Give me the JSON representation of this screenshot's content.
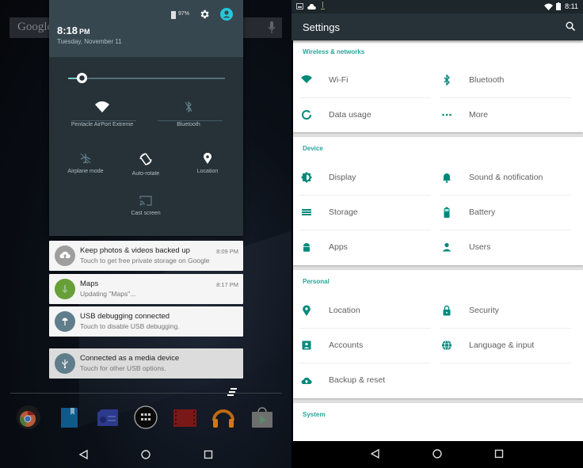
{
  "left_phone": {
    "search_bar": {
      "logo": "Google",
      "mic_icon": "mic-icon"
    },
    "quick_settings": {
      "battery_percent": "97%",
      "time": "8:18",
      "ampm": "PM",
      "date": "Tuesday, November 11",
      "brightness_level": 0.1,
      "tiles": [
        {
          "label": "Pentacle AirPort Extreme",
          "icon": "wifi-icon",
          "active": true
        },
        {
          "label": "Bluetooth",
          "icon": "bluetooth-off-icon",
          "active": false
        },
        {
          "label": "Airplane mode",
          "icon": "airplane-off-icon",
          "active": false
        },
        {
          "label": "Auto-rotate",
          "icon": "auto-rotate-icon",
          "active": true
        },
        {
          "label": "Location",
          "icon": "location-icon",
          "active": true
        },
        {
          "label": "Cast screen",
          "icon": "cast-icon",
          "active": false
        }
      ]
    },
    "notifications": [
      {
        "title": "Keep photos & videos backed up",
        "subtitle": "Touch to get free private storage on Google",
        "time": "8:09 PM",
        "icon": "cloud-upload-icon",
        "color": "#9e9e9e"
      },
      {
        "title": "Maps",
        "subtitle": "Updating \"Maps\"...",
        "time": "8:17 PM",
        "icon": "download-icon",
        "color": "#689f38"
      },
      {
        "title": "USB debugging connected",
        "subtitle": "Touch to disable USB debugging.",
        "time": "",
        "icon": "android-debug-icon",
        "color": "#607d8b"
      },
      {
        "title": "Connected as a media device",
        "subtitle": "Touch for other USB options.",
        "time": "",
        "icon": "usb-icon",
        "color": "#607d8b"
      }
    ],
    "dock": [
      "chrome-icon",
      "play-books-icon",
      "newsstand-icon",
      "app-drawer-icon",
      "play-movies-icon",
      "play-music-icon",
      "play-store-icon"
    ]
  },
  "right_phone": {
    "status_time": "8:11",
    "title": "Settings",
    "sections": [
      {
        "header": "Wireless & networks",
        "items": [
          {
            "label": "Wi-Fi",
            "icon": "wifi-icon"
          },
          {
            "label": "Bluetooth",
            "icon": "bluetooth-icon"
          },
          {
            "label": "Data usage",
            "icon": "data-usage-icon"
          },
          {
            "label": "More",
            "icon": "more-icon"
          }
        ]
      },
      {
        "header": "Device",
        "items": [
          {
            "label": "Display",
            "icon": "display-icon"
          },
          {
            "label": "Sound & notification",
            "icon": "bell-icon"
          },
          {
            "label": "Storage",
            "icon": "storage-icon"
          },
          {
            "label": "Battery",
            "icon": "battery-icon"
          },
          {
            "label": "Apps",
            "icon": "android-icon"
          },
          {
            "label": "Users",
            "icon": "user-icon"
          }
        ]
      },
      {
        "header": "Personal",
        "items": [
          {
            "label": "Location",
            "icon": "location-icon"
          },
          {
            "label": "Security",
            "icon": "lock-icon"
          },
          {
            "label": "Accounts",
            "icon": "account-icon"
          },
          {
            "label": "Language & input",
            "icon": "globe-icon"
          },
          {
            "label": "Backup & reset",
            "icon": "cloud-upload-icon"
          }
        ]
      },
      {
        "header": "System",
        "items": []
      }
    ]
  },
  "colors": {
    "accent": "#26a69a",
    "shade_bg": "#263238",
    "shade_header": "#37474f"
  }
}
